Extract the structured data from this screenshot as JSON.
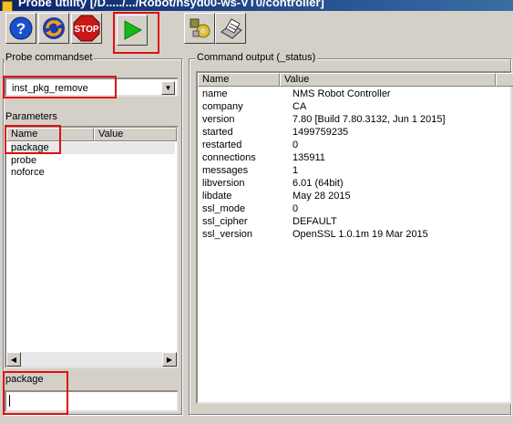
{
  "window": {
    "title": "Probe utility [/D...../.../Robot/nsyd00-ws-VT0/controller]"
  },
  "toolbar": {
    "help_icon": "help-icon",
    "refresh_icon": "refresh-icon",
    "stop_label": "STOP",
    "run_icon": "play-icon",
    "settings_icon": "settings-icon",
    "print_icon": "printer-icon"
  },
  "probe_commandset": {
    "label": "Probe commandset",
    "selected": "inst_pkg_remove"
  },
  "parameters": {
    "label": "Parameters",
    "columns": [
      "Name",
      "Value"
    ],
    "rows": [
      {
        "name": "package",
        "value": ""
      },
      {
        "name": "probe",
        "value": ""
      },
      {
        "name": "noforce",
        "value": ""
      }
    ]
  },
  "param_editor": {
    "label": "package",
    "value": ""
  },
  "command_output": {
    "label": "Command output (_status)",
    "columns": [
      "Name",
      "Value"
    ],
    "rows": [
      {
        "name": "name",
        "value": "NMS Robot Controller"
      },
      {
        "name": "company",
        "value": "CA"
      },
      {
        "name": "version",
        "value": "7.80 [Build 7.80.3132, Jun  1 2015]"
      },
      {
        "name": "started",
        "value": "1499759235"
      },
      {
        "name": "restarted",
        "value": "0"
      },
      {
        "name": "connections",
        "value": "135911"
      },
      {
        "name": "messages",
        "value": "1"
      },
      {
        "name": "libversion",
        "value": "6.01 (64bit)"
      },
      {
        "name": "libdate",
        "value": "May 28 2015"
      },
      {
        "name": "ssl_mode",
        "value": "0"
      },
      {
        "name": "ssl_cipher",
        "value": "DEFAULT"
      },
      {
        "name": "ssl_version",
        "value": "OpenSSL 1.0.1m 19 Mar 2015"
      }
    ]
  },
  "colors": {
    "highlight_box": "#e01010",
    "titlebar": "#0a246a",
    "run_green": "#18b818",
    "stop_red": "#c81818"
  }
}
